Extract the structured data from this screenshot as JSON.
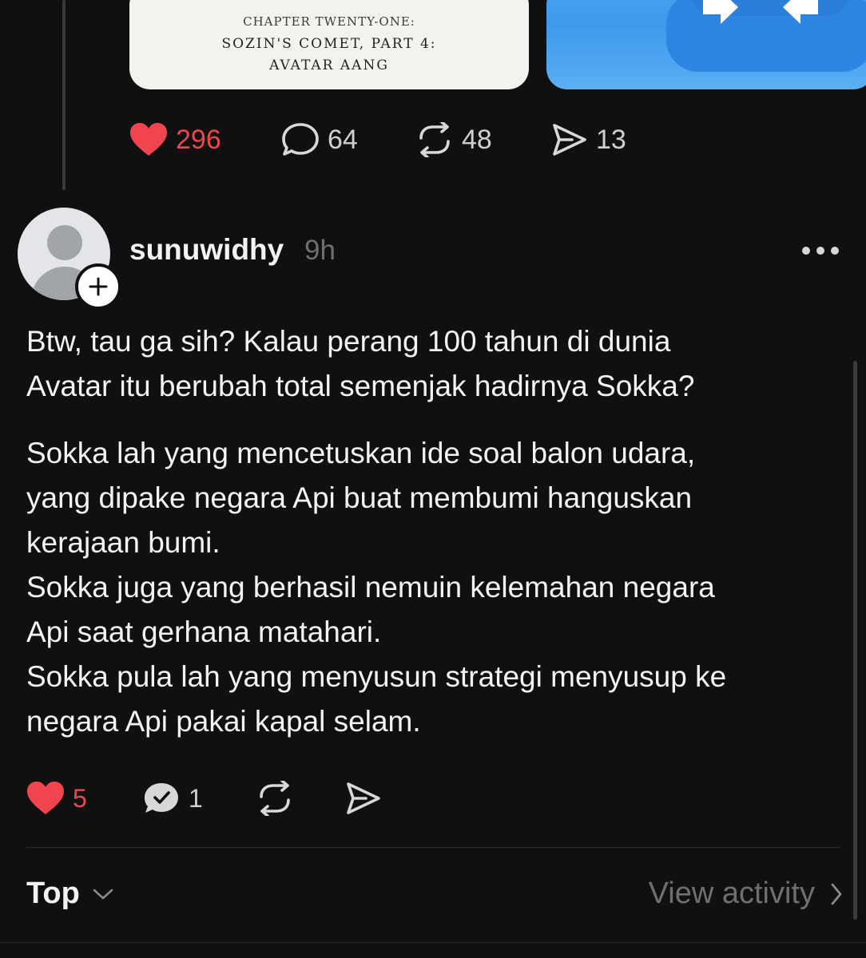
{
  "previous_post": {
    "media_chapter": {
      "line1": "CHAPTER TWENTY-ONE:",
      "line2": "SOZIN'S COMET, PART 4:",
      "line3": "AVATAR AANG"
    },
    "actions": {
      "likes": "296",
      "replies": "64",
      "reposts": "48",
      "shares": "13"
    }
  },
  "post": {
    "username": "sunuwidhy",
    "timestamp": "9h",
    "paragraphs": [
      "Btw, tau ga sih? Kalau perang 100 tahun di dunia\nAvatar itu berubah total semenjak hadirnya Sokka?",
      "Sokka lah yang mencetuskan ide soal balon udara,\nyang dipake negara Api buat membumi hanguskan\nkerajaan bumi.\nSokka juga yang berhasil nemuin kelemahan negara\nApi saat gerhana matahari.\nSokka pula lah yang menyusun strategi menyusup ke\nnegara Api pakai kapal selam."
    ],
    "actions": {
      "likes": "5",
      "replies": "1"
    }
  },
  "footer": {
    "sort_label": "Top",
    "view_activity_label": "View activity"
  },
  "colors": {
    "background": "#101010",
    "like_red": "#f0454f",
    "text": "#f3f3f3",
    "muted": "#6f6f6f"
  },
  "icons": [
    "heart-icon",
    "comment-icon",
    "repost-icon",
    "share-icon",
    "plus-icon",
    "more-icon",
    "chevron-down-icon",
    "chevron-right-icon"
  ]
}
